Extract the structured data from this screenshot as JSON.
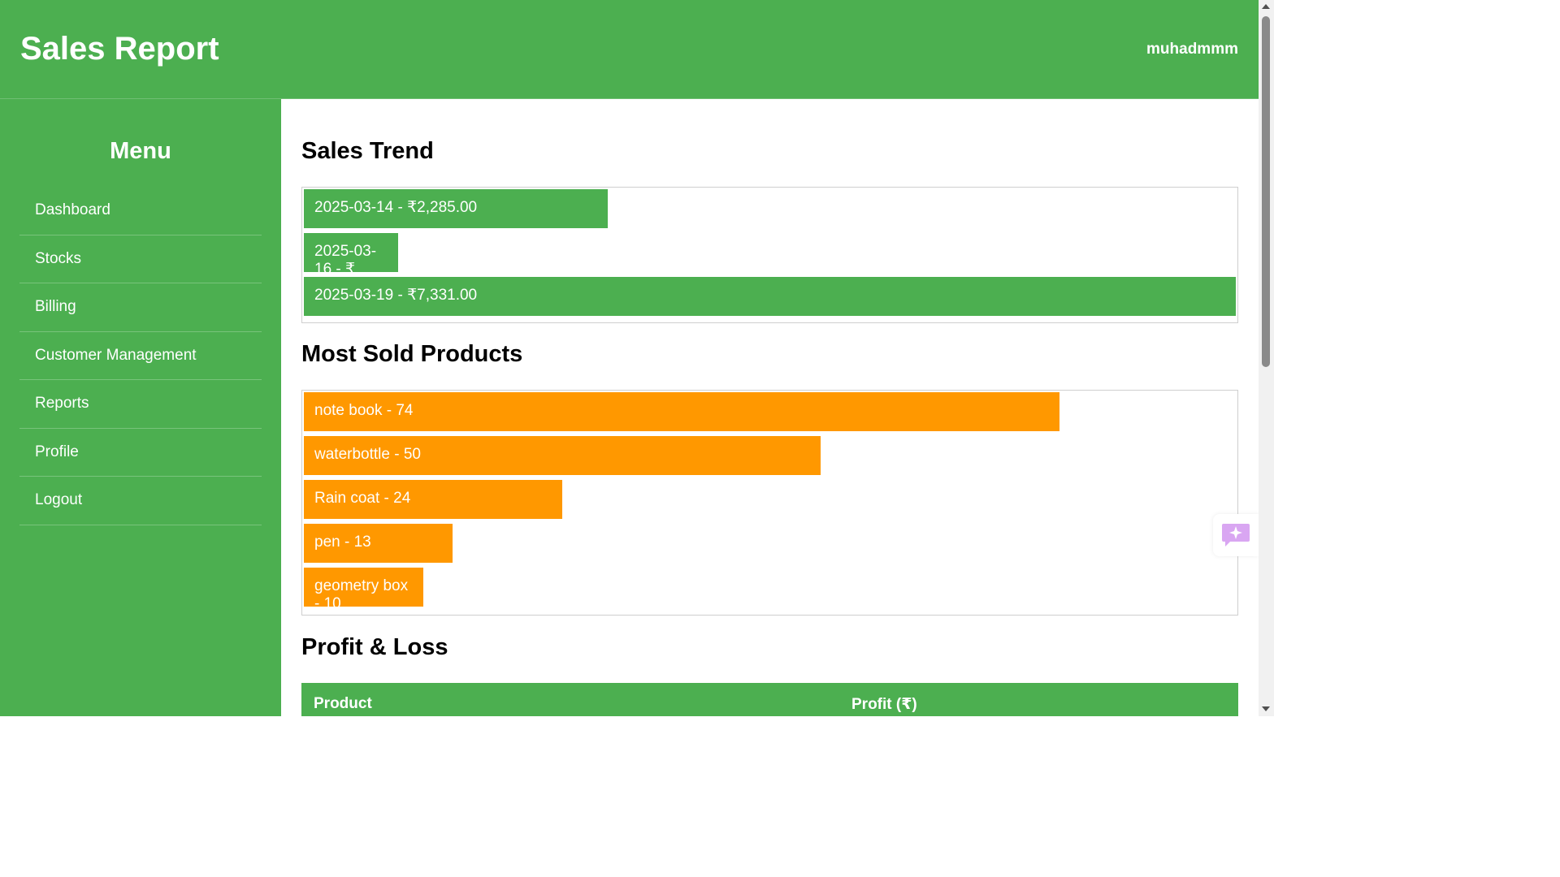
{
  "header": {
    "title": "Sales Report",
    "username": "muhadmmm"
  },
  "sidebar": {
    "title": "Menu",
    "items": [
      {
        "label": "Dashboard"
      },
      {
        "label": "Stocks"
      },
      {
        "label": "Billing"
      },
      {
        "label": "Customer Management"
      },
      {
        "label": "Reports"
      },
      {
        "label": "Profile"
      },
      {
        "label": "Logout"
      }
    ]
  },
  "sales_trend": {
    "title": "Sales Trend",
    "bars": [
      {
        "label": "2025-03-14 - ₹2,285.00",
        "date": "2025-03-14",
        "amount": 2285.0,
        "fraction": 0.3258
      },
      {
        "label": "2025-03-16 - ₹",
        "date": "2025-03-16",
        "fraction": 0.1014
      },
      {
        "label": "2025-03-19 - ₹7,331.00",
        "date": "2025-03-19",
        "amount": 7331.0,
        "fraction": 1.0
      }
    ]
  },
  "most_sold": {
    "title": "Most Sold Products",
    "bars": [
      {
        "label": "note book - 74",
        "name": "note book",
        "qty": 74,
        "fraction": 0.811
      },
      {
        "label": "waterbottle - 50",
        "name": "waterbottle",
        "qty": 50,
        "fraction": 0.5548
      },
      {
        "label": "Rain coat - 24",
        "name": "Rain coat",
        "qty": 24,
        "fraction": 0.2771
      },
      {
        "label": "pen - 13",
        "name": "pen",
        "qty": 13,
        "fraction": 0.1597
      },
      {
        "label": "geometry box - 10",
        "name": "geometry box",
        "qty": 10,
        "fraction": 0.128
      }
    ]
  },
  "profit_loss": {
    "title": "Profit & Loss",
    "columns": [
      "Product",
      "Profit (₹)"
    ]
  },
  "colors": {
    "primary": "#4caf50",
    "accent": "#ff9800",
    "text_on_primary": "#ffffff"
  },
  "icons": {
    "floating_button": "sparkle-chat-icon"
  }
}
